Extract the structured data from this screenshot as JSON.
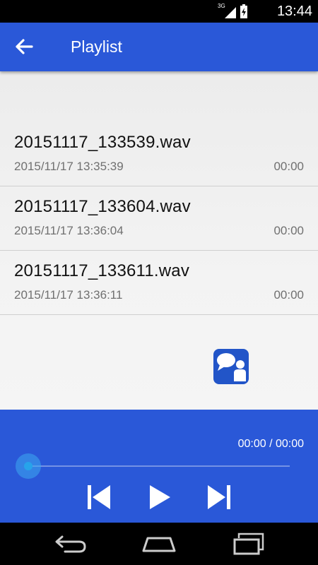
{
  "status_bar": {
    "network": "3G",
    "time": "13:44"
  },
  "app_bar": {
    "title": "Playlist",
    "back_icon": "arrow-left-icon"
  },
  "playlist": [
    {
      "name": "20151117_133539.wav",
      "date": "2015/11/17 13:35:39",
      "duration": "00:00"
    },
    {
      "name": "20151117_133604.wav",
      "date": "2015/11/17 13:36:04",
      "duration": "00:00"
    },
    {
      "name": "20151117_133611.wav",
      "date": "2015/11/17 13:36:11",
      "duration": "00:00"
    }
  ],
  "player": {
    "time_display": "00:00 / 00:00",
    "progress": 0,
    "controls": [
      "skip-previous-icon",
      "play-icon",
      "skip-next-icon"
    ]
  },
  "colors": {
    "primary": "#2a58d8",
    "accent": "#27a3ea"
  }
}
